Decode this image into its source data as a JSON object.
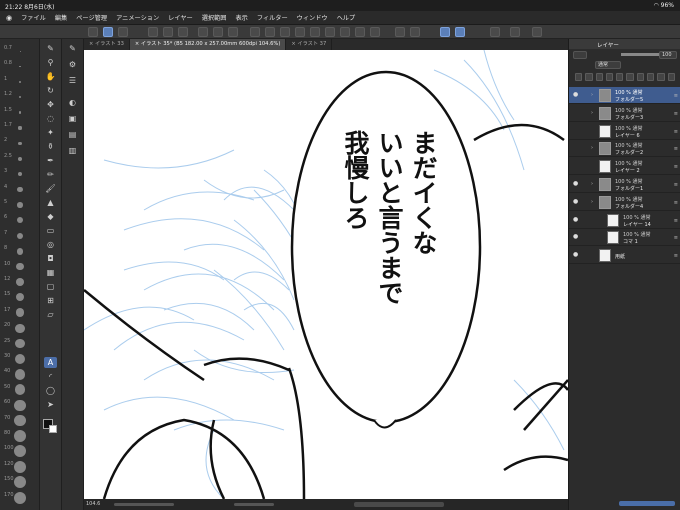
{
  "status": {
    "time_date": "21:22  8月6日(水)",
    "battery": "96%"
  },
  "menu": [
    "ファイル",
    "編集",
    "ページ管理",
    "アニメーション",
    "レイヤー",
    "選択範囲",
    "表示",
    "フィルター",
    "ウィンドウ",
    "ヘルプ"
  ],
  "tabs": [
    {
      "label": "× イラスト 33"
    },
    {
      "label": "× イラスト 35* (B5 182.00 x 257.00mm 600dpi 104.6%)"
    },
    {
      "label": "× イラスト 37"
    }
  ],
  "brush_sizes": [
    "0.7",
    "0.8",
    "1",
    "1.2",
    "1.5",
    "1.7",
    "2",
    "2.5",
    "3",
    "4",
    "5",
    "6",
    "7",
    "8",
    "10",
    "12",
    "15",
    "17",
    "20",
    "25",
    "30",
    "40",
    "50",
    "60",
    "70",
    "80",
    "100",
    "120",
    "150",
    "170"
  ],
  "speech_bubble": {
    "columns": [
      "まだイくな",
      "いいと言うまで",
      "我慢しろ"
    ]
  },
  "layer_panel": {
    "tab_label": "レイヤー",
    "blend_mode": "通常",
    "opacity": "100",
    "layers": [
      {
        "opacity_mode": "100 % 通常",
        "name": "フォルダー5",
        "type": "folder",
        "selected": true,
        "visible": true,
        "indent": 0
      },
      {
        "opacity_mode": "100 % 通常",
        "name": "フォルダー3",
        "type": "folder",
        "selected": false,
        "visible": false,
        "indent": 0
      },
      {
        "opacity_mode": "100 % 通常",
        "name": "レイヤー 6",
        "type": "layer",
        "selected": false,
        "visible": false,
        "indent": 0
      },
      {
        "opacity_mode": "100 % 通常",
        "name": "フォルダー2",
        "type": "folder",
        "selected": false,
        "visible": false,
        "indent": 0
      },
      {
        "opacity_mode": "100 % 通常",
        "name": "レイヤー 2",
        "type": "layer",
        "selected": false,
        "visible": false,
        "indent": 0
      },
      {
        "opacity_mode": "100 % 通常",
        "name": "フォルダー1",
        "type": "folder",
        "selected": false,
        "visible": true,
        "indent": 0
      },
      {
        "opacity_mode": "100 % 通常",
        "name": "フォルダー4",
        "type": "folder",
        "selected": false,
        "visible": true,
        "indent": 0
      },
      {
        "opacity_mode": "100 % 通常",
        "name": "レイヤー 14",
        "type": "layer",
        "selected": false,
        "visible": true,
        "indent": 1
      },
      {
        "opacity_mode": "100 % 通常",
        "name": "コマ 1",
        "type": "layer",
        "selected": false,
        "visible": true,
        "indent": 1
      },
      {
        "opacity_mode": "",
        "name": "用紙",
        "type": "paper",
        "selected": false,
        "visible": true,
        "indent": 0
      }
    ]
  },
  "zoom": "104.6",
  "colors": {
    "accent": "#4c6ea8",
    "sketch": "#9cc4ea",
    "ink": "#111111"
  }
}
